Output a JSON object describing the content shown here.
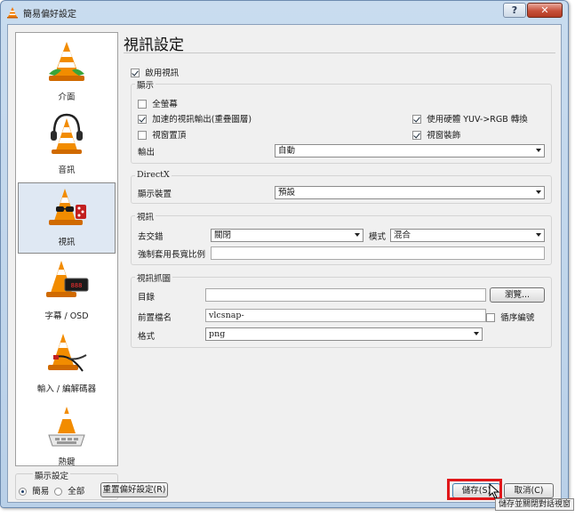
{
  "window": {
    "title": "簡易偏好設定",
    "help_label": "?",
    "close_label": "✕"
  },
  "sidebar": {
    "items": [
      {
        "label": "介面",
        "icon": "vlc-cone-icon"
      },
      {
        "label": "音訊",
        "icon": "cone-headphones-icon"
      },
      {
        "label": "視訊",
        "icon": "cone-glasses-icon",
        "selected": true
      },
      {
        "label": "字幕 / OSD",
        "icon": "cone-subtitle-icon"
      },
      {
        "label": "輸入 / 編解碼器",
        "icon": "cone-cables-icon"
      },
      {
        "label": "熱鍵",
        "icon": "cone-keyboard-icon"
      }
    ]
  },
  "show_settings": {
    "title": "顯示設定",
    "simple": "簡易",
    "all": "全部",
    "selected": "simple"
  },
  "page": {
    "title": "視訊設定",
    "enable_video": "啟用視訊",
    "display": {
      "title": "顯示",
      "fullscreen": "全螢幕",
      "accelerated": "加速的視訊輸出(重疊圖層)",
      "always_on_top": "視窗置頂",
      "yuv_rgb": "使用硬體 YUV->RGB 轉換",
      "window_decorations": "視窗裝飾",
      "output_label": "輸出",
      "output_value": "自動"
    },
    "directx": {
      "title": "DirectX",
      "device_label": "顯示裝置",
      "device_value": "預設"
    },
    "video": {
      "title": "視訊",
      "deinterlace_label": "去交錯",
      "deinterlace_value": "關閉",
      "mode_label": "模式",
      "mode_value": "混合",
      "aspect_label": "強制套用長寬比例",
      "aspect_value": ""
    },
    "snapshot": {
      "title": "視訊抓圖",
      "dir_label": "目錄",
      "dir_value": "",
      "browse_label": "瀏覽...",
      "prefix_label": "前置檔名",
      "prefix_value": "vlcsnap-",
      "sequential_label": "循序編號",
      "format_label": "格式",
      "format_value": "png"
    }
  },
  "footer": {
    "reset_label": "重置偏好設定(R)",
    "save_label": "儲存(S)",
    "cancel_label": "取消(C)",
    "tooltip": "儲存並關閉對話視窗"
  },
  "state": {
    "enable_video": true,
    "fullscreen": false,
    "accelerated": true,
    "always_on_top": false,
    "yuv_rgb": true,
    "window_decorations": true,
    "sequential": false
  }
}
